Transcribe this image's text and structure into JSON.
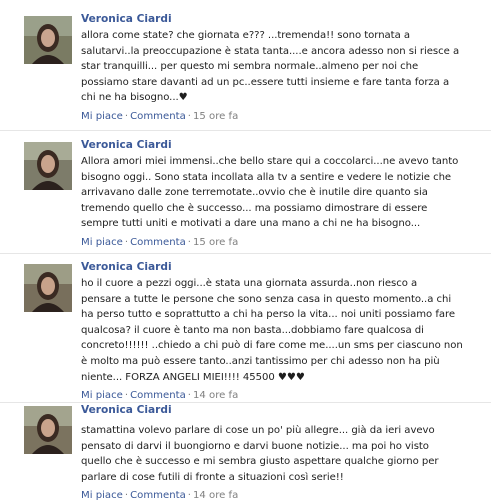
{
  "posts": [
    {
      "author": "Veronica Ciardi",
      "text": "allora come state? che giornata e??? ...tremenda!! sono tornata a\nsalutarvi..la preoccupazione è stata tanta....e ancora adesso non si riesce a\nstar tranquilli... per questo mi sembra normale..almeno per noi che\npossiamo stare davanti ad un pc..essere tutti insieme e fare tanta forza a\nchi ne ha bisogno...♥",
      "like": "Mi piace",
      "comment": "Commenta",
      "time": "15 ore fa"
    },
    {
      "author": "Veronica Ciardi",
      "text": "Allora amori miei immensi..che bello stare qui a coccolarci...ne avevo tanto\nbisogno oggi.. Sono stata incollata alla tv a sentire e vedere le notizie che\narrivavano dalle zone terremotate..ovvio che è inutile dire quanto sia\ntremendo quello che è successo... ma possiamo dimostrare di essere\nsempre tutti uniti e motivati a dare una mano a chi ne ha bisogno...",
      "like": "Mi piace",
      "comment": "Commenta",
      "time": "15 ore fa"
    },
    {
      "author": "Veronica Ciardi",
      "text": "ho il cuore a pezzi oggi...è stata una giornata assurda..non riesco a\npensare a tutte le persone che sono senza casa in questo momento..a chi\nha perso tutto e soprattutto a chi ha perso la vita... noi uniti possiamo fare\nqualcosa? il cuore è tanto ma non basta...dobbiamo fare qualcosa di\nconcreto!!!!!! ..chiedo a chi può di fare come me....un sms per ciascuno non\nè molto ma può essere tanto..anzi tantissimo per chi adesso non ha più\nniente... FORZA ANGELI MIEI!!!! 45500 ♥♥♥",
      "like": "Mi piace",
      "comment": "Commenta",
      "time": "14 ore fa"
    },
    {
      "author": "Veronica Ciardi",
      "text": "stamattina volevo parlare di cose un po' più allegre... già da ieri avevo\npensato di darvi il buongiorno e darvi buone notizie... ma poi ho visto\nquello che è successo e mi sembra giusto aspettare qualche giorno per\nparlare di cose futili di fronte a situazioni così serie!!",
      "like": "Mi piace",
      "comment": "Commenta",
      "time": "14 ore fa"
    }
  ],
  "sep_char": "·"
}
